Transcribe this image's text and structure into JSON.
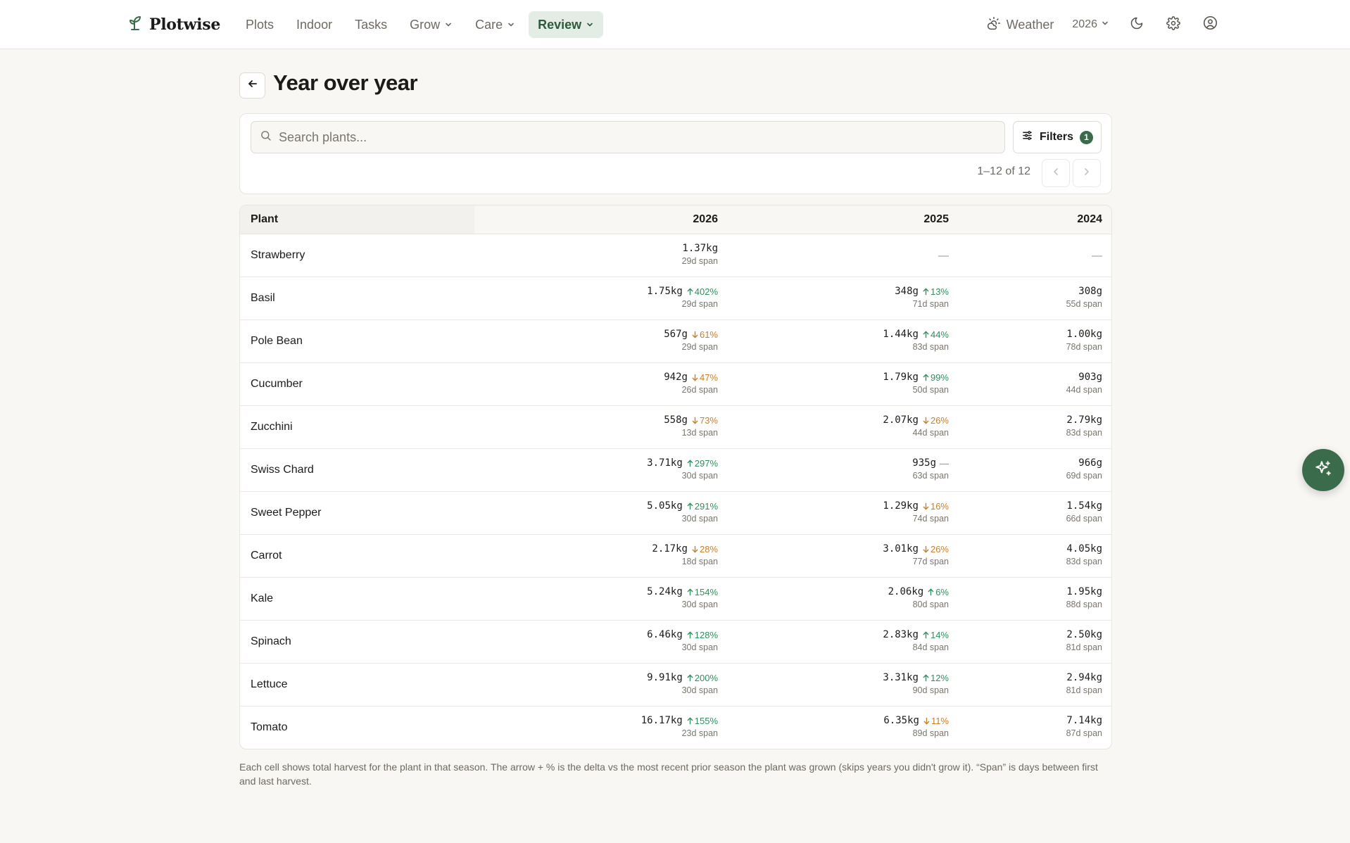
{
  "app": {
    "brand": "Plotwise"
  },
  "nav": [
    {
      "label": "Plots",
      "dropdown": false,
      "active": false
    },
    {
      "label": "Indoor",
      "dropdown": false,
      "active": false
    },
    {
      "label": "Tasks",
      "dropdown": false,
      "active": false
    },
    {
      "label": "Grow",
      "dropdown": true,
      "active": false
    },
    {
      "label": "Care",
      "dropdown": true,
      "active": false
    },
    {
      "label": "Review",
      "dropdown": true,
      "active": true
    }
  ],
  "toolbar": {
    "weather_label": "Weather",
    "year_selector": "2026"
  },
  "page": {
    "title": "Year over year"
  },
  "search": {
    "placeholder": "Search plants..."
  },
  "filters": {
    "label": "Filters",
    "count": "1"
  },
  "pagination": {
    "range_text": "1–12 of 12"
  },
  "table": {
    "headers": {
      "plant": "Plant",
      "years": [
        "2026",
        "2025",
        "2024"
      ]
    },
    "rows": [
      {
        "plant": "Strawberry",
        "cells": [
          {
            "value": "1.37kg",
            "delta": "",
            "dir": "",
            "span": "29d span"
          },
          {
            "empty": "—"
          },
          {
            "empty": "—"
          }
        ]
      },
      {
        "plant": "Basil",
        "cells": [
          {
            "value": "1.75kg",
            "delta": "402%",
            "dir": "up",
            "span": "29d span"
          },
          {
            "value": "348g",
            "delta": "13%",
            "dir": "up",
            "span": "71d span"
          },
          {
            "value": "308g",
            "delta": "",
            "dir": "",
            "span": "55d span"
          }
        ]
      },
      {
        "plant": "Pole Bean",
        "cells": [
          {
            "value": "567g",
            "delta": "61%",
            "dir": "down",
            "span": "29d span"
          },
          {
            "value": "1.44kg",
            "delta": "44%",
            "dir": "up",
            "span": "83d span"
          },
          {
            "value": "1.00kg",
            "delta": "",
            "dir": "",
            "span": "78d span"
          }
        ]
      },
      {
        "plant": "Cucumber",
        "cells": [
          {
            "value": "942g",
            "delta": "47%",
            "dir": "down",
            "span": "26d span"
          },
          {
            "value": "1.79kg",
            "delta": "99%",
            "dir": "up",
            "span": "50d span"
          },
          {
            "value": "903g",
            "delta": "",
            "dir": "",
            "span": "44d span"
          }
        ]
      },
      {
        "plant": "Zucchini",
        "cells": [
          {
            "value": "558g",
            "delta": "73%",
            "dir": "down",
            "span": "13d span"
          },
          {
            "value": "2.07kg",
            "delta": "26%",
            "dir": "down",
            "span": "44d span"
          },
          {
            "value": "2.79kg",
            "delta": "",
            "dir": "",
            "span": "83d span"
          }
        ]
      },
      {
        "plant": "Swiss Chard",
        "cells": [
          {
            "value": "3.71kg",
            "delta": "297%",
            "dir": "up",
            "span": "30d span"
          },
          {
            "value": "935g",
            "delta": "—",
            "dir": "flat",
            "span": "63d span"
          },
          {
            "value": "966g",
            "delta": "",
            "dir": "",
            "span": "69d span"
          }
        ]
      },
      {
        "plant": "Sweet Pepper",
        "cells": [
          {
            "value": "5.05kg",
            "delta": "291%",
            "dir": "up",
            "span": "30d span"
          },
          {
            "value": "1.29kg",
            "delta": "16%",
            "dir": "down",
            "span": "74d span"
          },
          {
            "value": "1.54kg",
            "delta": "",
            "dir": "",
            "span": "66d span"
          }
        ]
      },
      {
        "plant": "Carrot",
        "cells": [
          {
            "value": "2.17kg",
            "delta": "28%",
            "dir": "down",
            "span": "18d span"
          },
          {
            "value": "3.01kg",
            "delta": "26%",
            "dir": "down",
            "span": "77d span"
          },
          {
            "value": "4.05kg",
            "delta": "",
            "dir": "",
            "span": "83d span"
          }
        ]
      },
      {
        "plant": "Kale",
        "cells": [
          {
            "value": "5.24kg",
            "delta": "154%",
            "dir": "up",
            "span": "30d span"
          },
          {
            "value": "2.06kg",
            "delta": "6%",
            "dir": "up",
            "span": "80d span"
          },
          {
            "value": "1.95kg",
            "delta": "",
            "dir": "",
            "span": "88d span"
          }
        ]
      },
      {
        "plant": "Spinach",
        "cells": [
          {
            "value": "6.46kg",
            "delta": "128%",
            "dir": "up",
            "span": "30d span"
          },
          {
            "value": "2.83kg",
            "delta": "14%",
            "dir": "up",
            "span": "84d span"
          },
          {
            "value": "2.50kg",
            "delta": "",
            "dir": "",
            "span": "81d span"
          }
        ]
      },
      {
        "plant": "Lettuce",
        "cells": [
          {
            "value": "9.91kg",
            "delta": "200%",
            "dir": "up",
            "span": "30d span"
          },
          {
            "value": "3.31kg",
            "delta": "12%",
            "dir": "up",
            "span": "90d span"
          },
          {
            "value": "2.94kg",
            "delta": "",
            "dir": "",
            "span": "81d span"
          }
        ]
      },
      {
        "plant": "Tomato",
        "cells": [
          {
            "value": "16.17kg",
            "delta": "155%",
            "dir": "up",
            "span": "23d span"
          },
          {
            "value": "6.35kg",
            "delta": "11%",
            "dir": "down",
            "span": "89d span"
          },
          {
            "value": "7.14kg",
            "delta": "",
            "dir": "",
            "span": "87d span"
          }
        ]
      }
    ]
  },
  "footnote": "Each cell shows total harvest for the plant in that season. The arrow + % is the delta vs the most recent prior season the plant was grown (skips years you didn't grow it). “Span” is days between first and last harvest.",
  "icons": {
    "brand": "sprout-icon",
    "weather": "sun-cloud-icon",
    "theme": "moon-icon",
    "settings": "gear-icon",
    "account": "user-circle-icon",
    "back": "arrow-left-icon",
    "search": "search-icon",
    "filters": "sliders-icon",
    "fab": "sparkles-icon"
  },
  "colors": {
    "accent": "#3a6b4b",
    "up": "#2f8f5e",
    "down": "#c97f28",
    "active_nav_bg": "#e4ede5"
  }
}
